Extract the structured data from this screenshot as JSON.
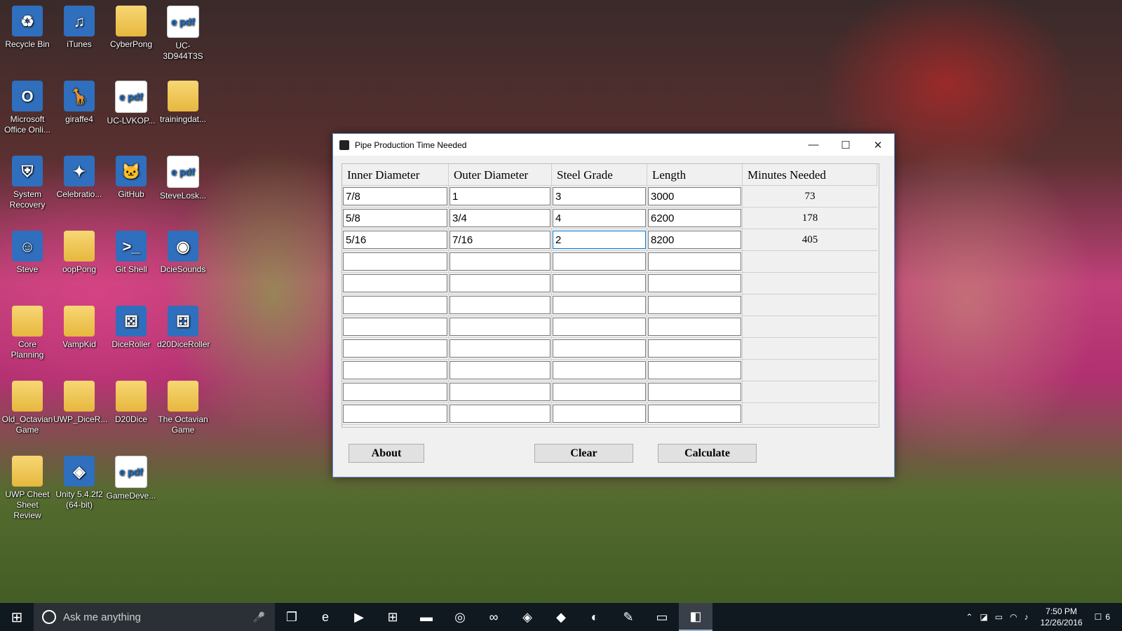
{
  "desktop": {
    "icons": [
      {
        "label": "Recycle Bin",
        "glyph": "♻"
      },
      {
        "label": "iTunes",
        "glyph": "♫"
      },
      {
        "label": "CyberPong",
        "glyph": ""
      },
      {
        "label": "UC-3D944T3S",
        "glyph": "e pdf"
      },
      {
        "label": "Microsoft Office Onli...",
        "glyph": "O"
      },
      {
        "label": "giraffe4",
        "glyph": "🦒"
      },
      {
        "label": "UC-LVKOP...",
        "glyph": "e pdf"
      },
      {
        "label": "trainingdat...",
        "glyph": ""
      },
      {
        "label": "System Recovery",
        "glyph": "⛨"
      },
      {
        "label": "Celebratio...",
        "glyph": "✦"
      },
      {
        "label": "GitHub",
        "glyph": "🐱"
      },
      {
        "label": "SteveLosk...",
        "glyph": "e pdf"
      },
      {
        "label": "Steve",
        "glyph": "☺"
      },
      {
        "label": "oopPong",
        "glyph": ""
      },
      {
        "label": "Git Shell",
        "glyph": ">_"
      },
      {
        "label": "DcieSounds",
        "glyph": "◉"
      },
      {
        "label": "Core Planning",
        "glyph": ""
      },
      {
        "label": "VampKid",
        "glyph": ""
      },
      {
        "label": "DiceRoller",
        "glyph": "⚄"
      },
      {
        "label": "d20DiceRoller",
        "glyph": "⚃"
      },
      {
        "label": "Old_Octavian Game",
        "glyph": ""
      },
      {
        "label": "UWP_DiceR...",
        "glyph": ""
      },
      {
        "label": "D20Dice",
        "glyph": ""
      },
      {
        "label": "The Octavian Game",
        "glyph": ""
      },
      {
        "label": "UWP Cheet Sheet Review",
        "glyph": ""
      },
      {
        "label": "Unity 5.4.2f2 (64-bit)",
        "glyph": "◈"
      },
      {
        "label": "GameDeve...",
        "glyph": "e pdf"
      }
    ]
  },
  "window": {
    "title": "Pipe Production Time Needed",
    "minimize": "—",
    "maximize": "☐",
    "close": "✕",
    "columns": [
      "Inner Diameter",
      "Outer Diameter",
      "Steel Grade",
      "Length",
      "Minutes Needed"
    ],
    "rows": [
      {
        "inner": "7/8",
        "outer": "1",
        "grade": "3",
        "length": "3000",
        "minutes": "73"
      },
      {
        "inner": "5/8",
        "outer": "3/4",
        "grade": "4",
        "length": "6200",
        "minutes": "178"
      },
      {
        "inner": "5/16",
        "outer": "7/16",
        "grade": "2",
        "length": "8200",
        "minutes": "405"
      },
      {
        "inner": "",
        "outer": "",
        "grade": "",
        "length": "",
        "minutes": ""
      },
      {
        "inner": "",
        "outer": "",
        "grade": "",
        "length": "",
        "minutes": ""
      },
      {
        "inner": "",
        "outer": "",
        "grade": "",
        "length": "",
        "minutes": ""
      },
      {
        "inner": "",
        "outer": "",
        "grade": "",
        "length": "",
        "minutes": ""
      },
      {
        "inner": "",
        "outer": "",
        "grade": "",
        "length": "",
        "minutes": ""
      },
      {
        "inner": "",
        "outer": "",
        "grade": "",
        "length": "",
        "minutes": ""
      },
      {
        "inner": "",
        "outer": "",
        "grade": "",
        "length": "",
        "minutes": ""
      },
      {
        "inner": "",
        "outer": "",
        "grade": "",
        "length": "",
        "minutes": ""
      }
    ],
    "buttons": {
      "about": "About",
      "clear": "Clear",
      "calculate": "Calculate"
    }
  },
  "taskbar": {
    "search_placeholder": "Ask me anything",
    "start_icon": "⊞",
    "apps": [
      {
        "name": "task-view-icon",
        "glyph": "❐"
      },
      {
        "name": "edge-icon",
        "glyph": "e"
      },
      {
        "name": "media-player-icon",
        "glyph": "▶"
      },
      {
        "name": "store-icon",
        "glyph": "⊞"
      },
      {
        "name": "file-explorer-icon",
        "glyph": "▬"
      },
      {
        "name": "chrome-icon",
        "glyph": "◎"
      },
      {
        "name": "visual-studio-icon",
        "glyph": "∞"
      },
      {
        "name": "unity-icon",
        "glyph": "◈"
      },
      {
        "name": "git-icon",
        "glyph": "◆"
      },
      {
        "name": "github-icon",
        "glyph": "◐"
      },
      {
        "name": "paint-icon",
        "glyph": "✎"
      },
      {
        "name": "app-icon",
        "glyph": "▭"
      },
      {
        "name": "pipe-app-icon",
        "glyph": "◧"
      }
    ],
    "time": "7:50 PM",
    "date": "12/26/2016",
    "notifications": "6"
  }
}
